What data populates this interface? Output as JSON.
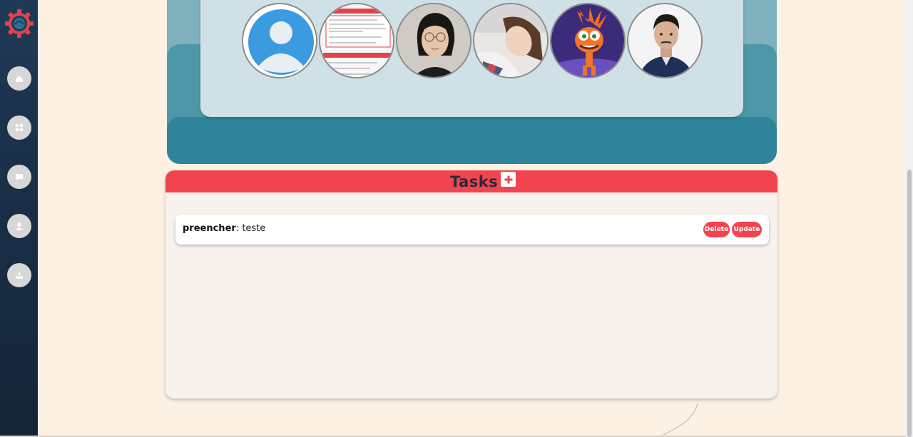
{
  "sidebar": {
    "items": [
      {
        "name": "home",
        "icon": "home-icon"
      },
      {
        "name": "dashboard",
        "icon": "grid-icon"
      },
      {
        "name": "chat",
        "icon": "chat-icon"
      },
      {
        "name": "profile",
        "icon": "user-icon"
      },
      {
        "name": "inbox",
        "icon": "inbox-icon"
      }
    ]
  },
  "team": {
    "members": [
      {
        "name": "default-avatar"
      },
      {
        "name": "screenshot-avatar"
      },
      {
        "name": "member-glasses"
      },
      {
        "name": "member-selfie"
      },
      {
        "name": "member-cartoon"
      },
      {
        "name": "member-shirt"
      }
    ]
  },
  "tasks": {
    "title": "Tasks",
    "add_label": "+",
    "items": [
      {
        "name": "preencher",
        "separator": ": ",
        "desc": "teste",
        "delete_label": "Delete",
        "update_label": "Update"
      }
    ]
  },
  "colors": {
    "accent": "#f2444f",
    "sidebar": "#1a2f48",
    "teal_dark": "#2f8499",
    "background": "#fdf1e4"
  }
}
